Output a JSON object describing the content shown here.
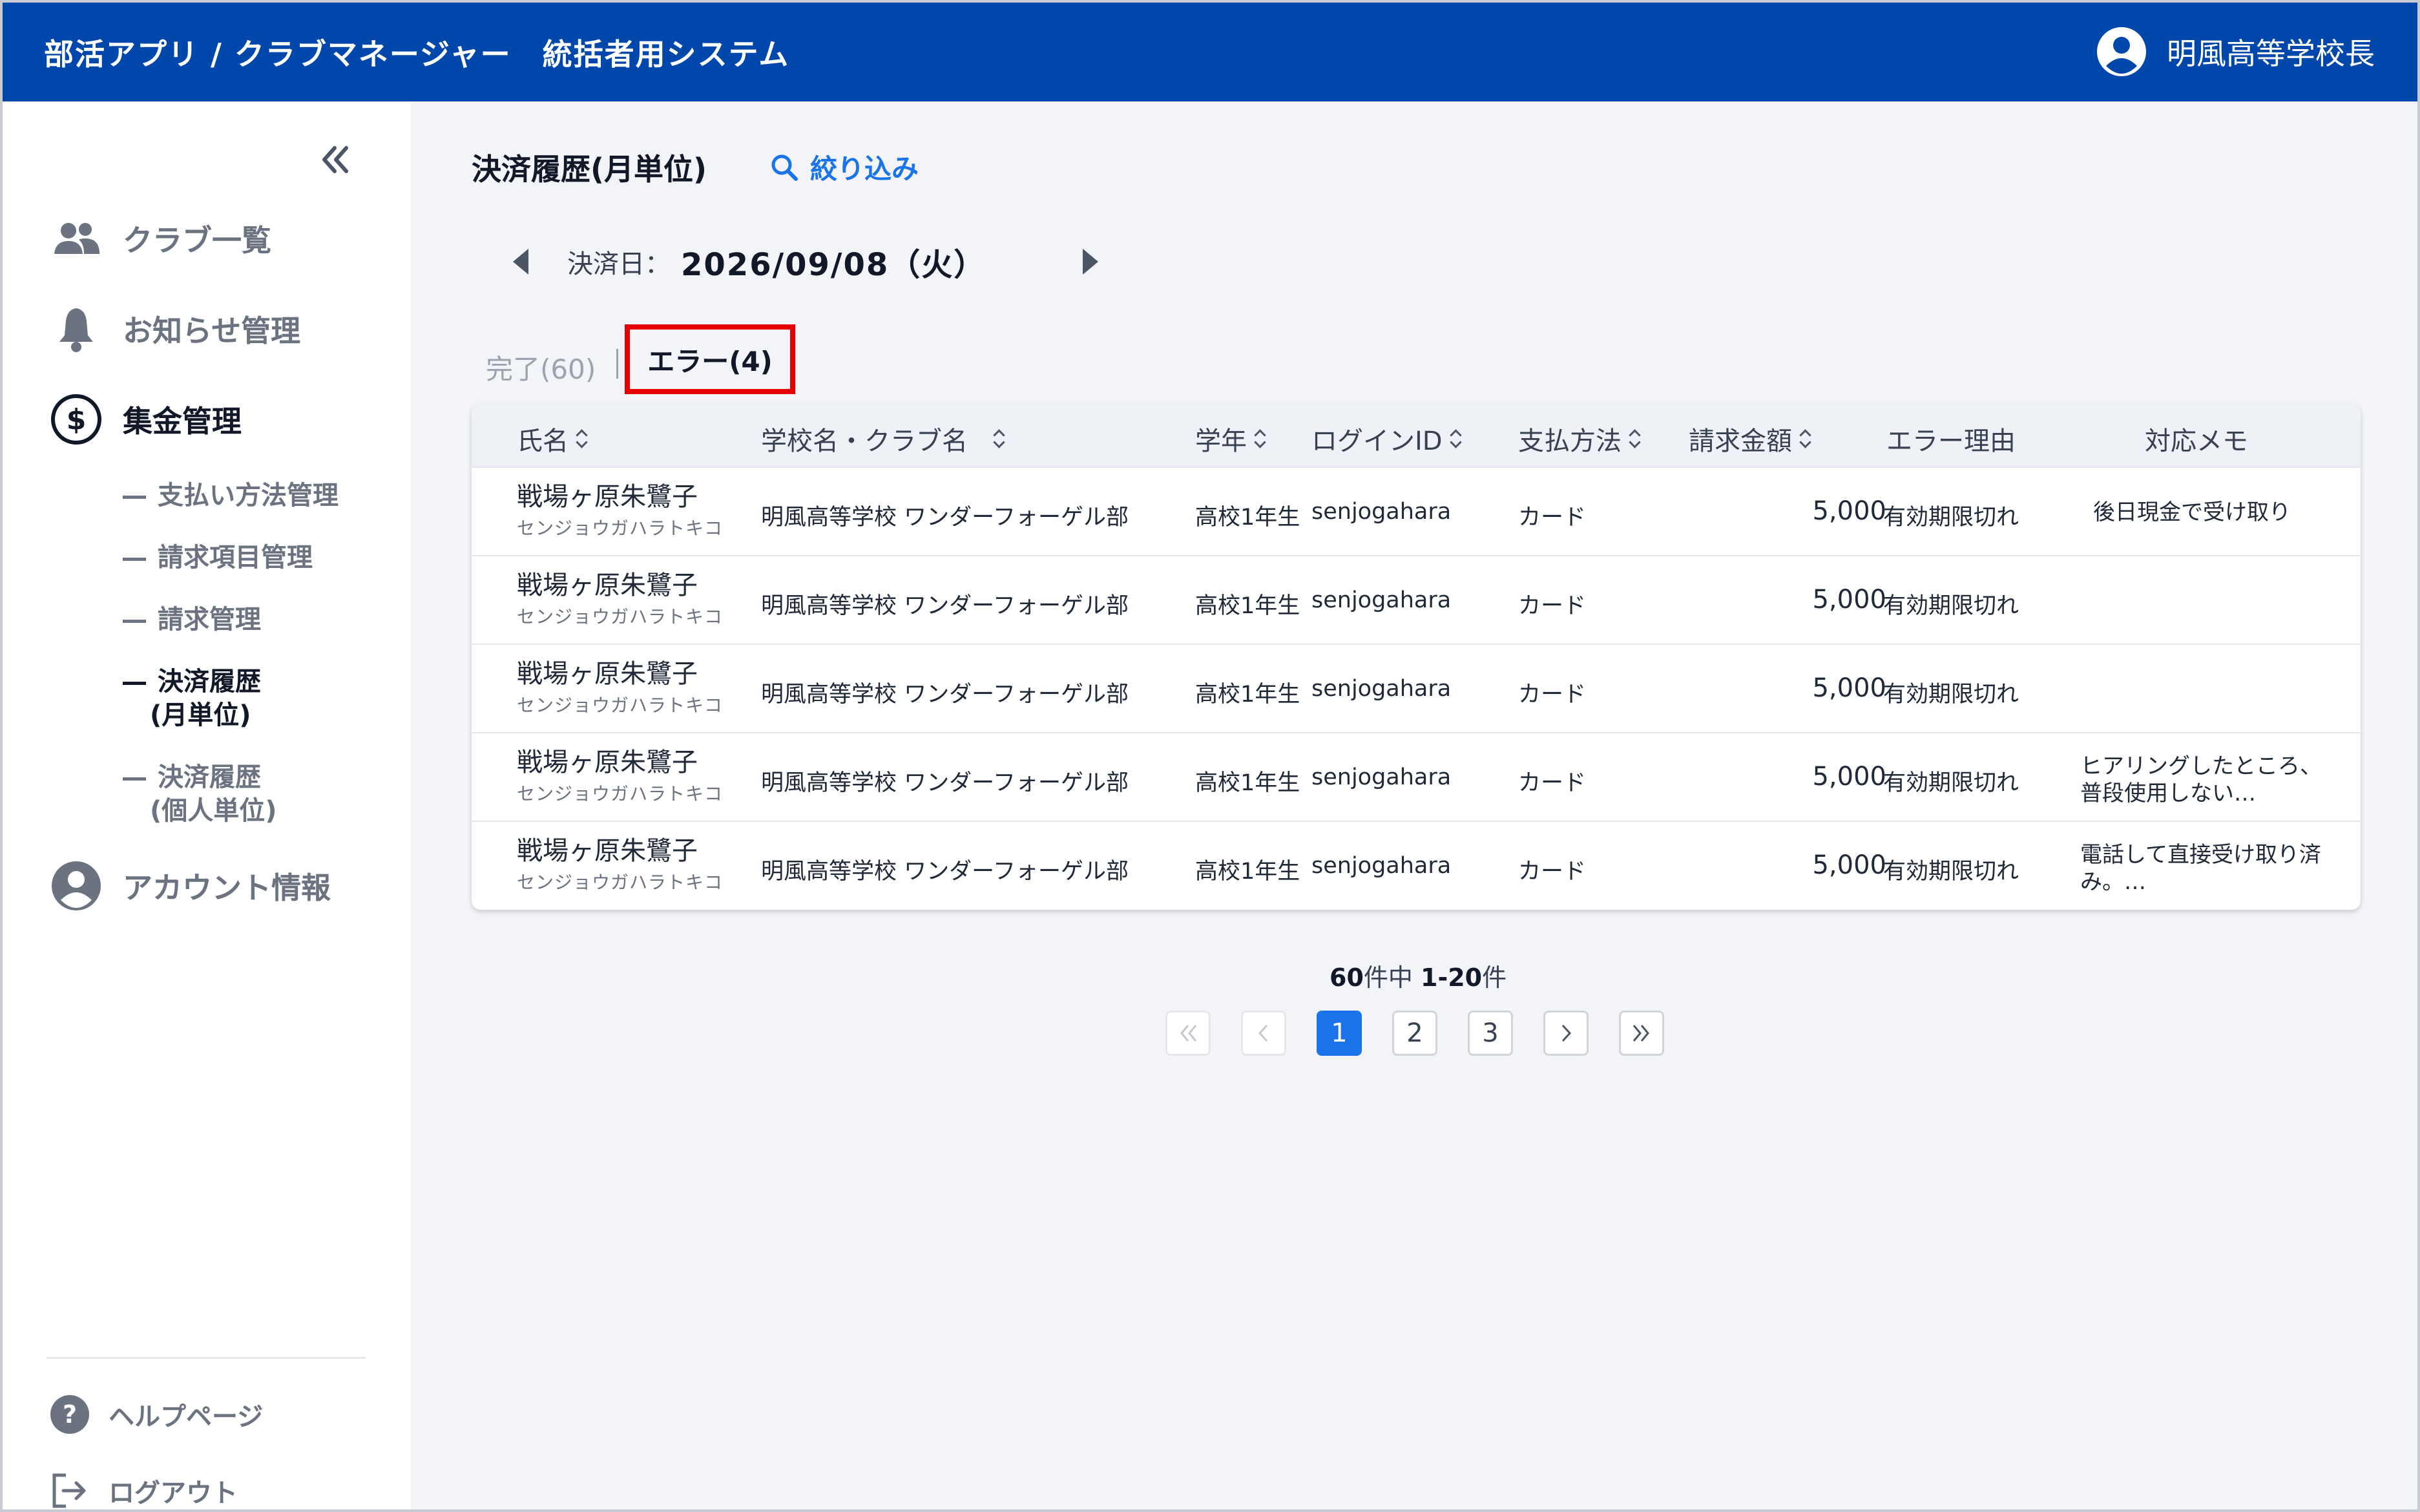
{
  "header": {
    "app_title": "部活アプリ / クラブマネージャー　統括者用システム",
    "user_name": "明風高等学校長"
  },
  "sidebar": {
    "items": [
      {
        "label": "クラブ一覧",
        "icon": "group-icon"
      },
      {
        "label": "お知らせ管理",
        "icon": "bell-icon"
      },
      {
        "label": "集金管理",
        "icon": "dollar-icon"
      }
    ],
    "sub_items": [
      {
        "label": "支払い方法管理"
      },
      {
        "label": "請求項目管理"
      },
      {
        "label": "請求管理"
      },
      {
        "label": "決済履歴",
        "label2": "(月単位)"
      },
      {
        "label": "決済履歴",
        "label2": "(個人単位)"
      }
    ],
    "account": {
      "label": "アカウント情報"
    },
    "help": {
      "label": "ヘルプページ"
    },
    "logout": {
      "label": "ログアウト"
    }
  },
  "main": {
    "title": "決済履歴(月単位)",
    "filter_label": "絞り込み",
    "date_label": "決済日：",
    "date_value": "2026/09/08（火）",
    "tabs": {
      "done": "完了(60)",
      "error": "エラー(4)"
    },
    "columns": [
      "氏名",
      "学校名・クラブ名",
      "学年",
      "ログインID",
      "支払方法",
      "請求金額",
      "エラー理由",
      "対応メモ"
    ],
    "rows": [
      {
        "name": "戦場ヶ原朱鷺子",
        "kana": "センジョウガハラトキコ",
        "school": "明風高等学校 ワンダーフォーゲル部",
        "grade": "高校1年生",
        "login": "senjogahara",
        "method": "カード",
        "amount": "5,000",
        "reason": "有効期限切れ",
        "memo": "後日現金で受け取り"
      },
      {
        "name": "戦場ヶ原朱鷺子",
        "kana": "センジョウガハラトキコ",
        "school": "明風高等学校 ワンダーフォーゲル部",
        "grade": "高校1年生",
        "login": "senjogahara",
        "method": "カード",
        "amount": "5,000",
        "reason": "有効期限切れ",
        "memo": ""
      },
      {
        "name": "戦場ヶ原朱鷺子",
        "kana": "センジョウガハラトキコ",
        "school": "明風高等学校 ワンダーフォーゲル部",
        "grade": "高校1年生",
        "login": "senjogahara",
        "method": "カード",
        "amount": "5,000",
        "reason": "有効期限切れ",
        "memo": ""
      },
      {
        "name": "戦場ヶ原朱鷺子",
        "kana": "センジョウガハラトキコ",
        "school": "明風高等学校 ワンダーフォーゲル部",
        "grade": "高校1年生",
        "login": "senjogahara",
        "method": "カード",
        "amount": "5,000",
        "reason": "有効期限切れ",
        "memo": "ヒアリングしたところ、普段使用しない…"
      },
      {
        "name": "戦場ヶ原朱鷺子",
        "kana": "センジョウガハラトキコ",
        "school": "明風高等学校 ワンダーフォーゲル部",
        "grade": "高校1年生",
        "login": "senjogahara",
        "method": "カード",
        "amount": "5,000",
        "reason": "有効期限切れ",
        "memo": "電話して直接受け取り済み。…"
      }
    ]
  },
  "pagination": {
    "total": "60",
    "total_suffix": "件中",
    "range": "1-20",
    "range_suffix": "件",
    "pages": [
      "1",
      "2",
      "3"
    ],
    "current_page": "1"
  },
  "colors": {
    "brand": "#0047ab",
    "accent": "#1a73e8",
    "highlight_border": "#e60000"
  }
}
